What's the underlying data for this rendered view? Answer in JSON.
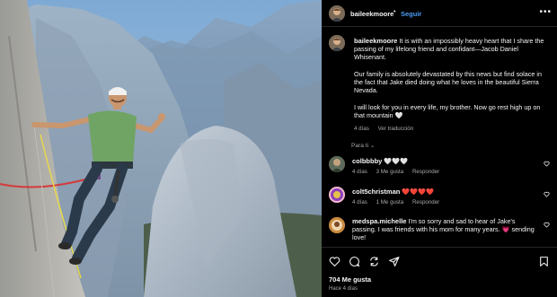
{
  "post": {
    "author": "baileekmoore",
    "follow_label": "Seguir",
    "more_label": "•••",
    "caption_user": "baileekmoore",
    "caption_p1": "It is with an impossibly heavy heart that I share the passing of my lifelong friend and confidant—Jacob Daniel Whisenant.",
    "caption_p2": "Our family is absolutely devastated by this news but find solace in the fact that Jake died doing what he loves in the beautiful Sierra Nevada.",
    "caption_p3": "I will look for you in every life, my brother. Now go rest high up on that mountain 🤍",
    "caption_age": "4 días",
    "translate_label": "Ver traducción",
    "for_you_label": "Para ti ⌄"
  },
  "comments": [
    {
      "user": "colbbbby",
      "text": "🤍🤍🤍",
      "age": "4 días",
      "likes": "3 Me gusta",
      "reply": "Responder"
    },
    {
      "user": "colt5christman",
      "text": "❤️❤️❤️❤️",
      "age": "4 días",
      "likes": "1 Me gusta",
      "reply": "Responder"
    },
    {
      "user": "medspa.michelle",
      "text": "I'm so sorry and sad to hear of Jake's passing. I was friends with his mom for many years. 💗 sending love!",
      "age": "",
      "likes": "",
      "reply": ""
    }
  ],
  "footer": {
    "likes": "704 Me gusta",
    "ago": "Hace 4 días"
  },
  "icons": {
    "like": "heart-icon",
    "comment": "comment-icon",
    "share": "share-icon",
    "repost": "repost-icon",
    "save": "bookmark-icon"
  },
  "colors": {
    "background": "#000000",
    "link": "#4c9cf5",
    "muted": "#a8a8a8"
  }
}
